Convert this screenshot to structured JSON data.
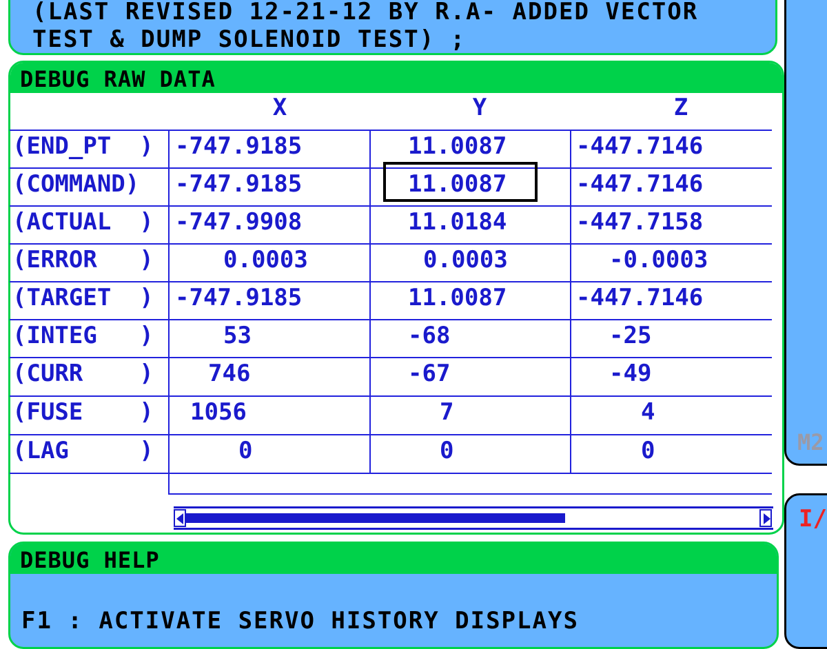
{
  "header": {
    "line1": "(LAST REVISED 12-21-12 BY R.A- ADDED VECTOR",
    "line2": "TEST & DUMP SOLENOID TEST) ;"
  },
  "raw_data": {
    "title": "DEBUG RAW DATA",
    "columns": [
      "X",
      "Y",
      "Z"
    ],
    "rows": [
      {
        "label": "(END_PT  )",
        "x": "-747.9185",
        "y": "11.0087",
        "z": "-447.7146"
      },
      {
        "label": "(COMMAND)",
        "x": "-747.9185",
        "y": "11.0087",
        "z": "-447.7146"
      },
      {
        "label": "(ACTUAL  )",
        "x": "-747.9908",
        "y": "11.0184",
        "z": "-447.7158"
      },
      {
        "label": "(ERROR   )",
        "x": "0.0003",
        "y": "0.0003",
        "z": "-0.0003"
      },
      {
        "label": "(TARGET  )",
        "x": "-747.9185",
        "y": "11.0087",
        "z": "-447.7146"
      },
      {
        "label": "(INTEG   )",
        "x": "53",
        "y": "-68",
        "z": "-25"
      },
      {
        "label": "(CURR    )",
        "x": "746",
        "y": "-67",
        "z": "-49"
      },
      {
        "label": "(FUSE    )",
        "x": "1056",
        "y": "7",
        "z": "4"
      },
      {
        "label": "(LAG     )",
        "x": "0",
        "y": "0",
        "z": "0"
      }
    ]
  },
  "help": {
    "title": "DEBUG HELP",
    "line1": "F1 : ACTIVATE SERVO HISTORY DISPLAYS"
  },
  "side": {
    "m2_label": "M2",
    "io_label": "I/"
  },
  "colors": {
    "panel_blue": "#66b3ff",
    "header_green": "#00d24a",
    "text_blue": "#1a1acc",
    "grid_blue": "#2222dd",
    "io_red": "#ee2222"
  }
}
